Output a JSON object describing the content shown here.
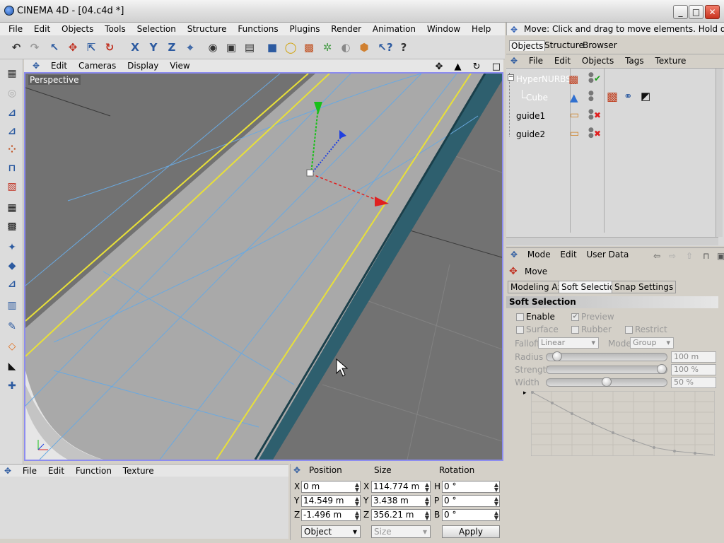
{
  "window": {
    "title": "CINEMA 4D - [04.c4d *]",
    "min": "_",
    "max": "□",
    "close": "✕"
  },
  "menu": [
    "File",
    "Edit",
    "Objects",
    "Tools",
    "Selection",
    "Structure",
    "Functions",
    "Plugins",
    "Render",
    "Animation",
    "Window",
    "Help"
  ],
  "status_hint": "Move: Click and drag to move elements. Hold down SHIFT",
  "viewport": {
    "menu": [
      "Edit",
      "Cameras",
      "Display",
      "View"
    ],
    "label": "Perspective"
  },
  "object_manager": {
    "tabs": [
      "Objects",
      "Structure",
      "Browser"
    ],
    "active_tab": "Objects",
    "menu": [
      "File",
      "Edit",
      "Objects",
      "Tags",
      "Texture"
    ],
    "objects": [
      {
        "name": "HyperNURBS",
        "status": "✔"
      },
      {
        "name": "Cube",
        "status": ""
      },
      {
        "name": "guide1",
        "status": "✖"
      },
      {
        "name": "guide2",
        "status": "✖"
      }
    ]
  },
  "attributes": {
    "menu": [
      "Mode",
      "Edit",
      "User Data"
    ],
    "tool": "Move",
    "tabs": [
      "Modeling Axis",
      "Soft Selection",
      "Snap Settings"
    ],
    "active_tab": "Soft Selection",
    "section": "Soft Selection",
    "enable": "Enable",
    "preview": "Preview",
    "surface": "Surface",
    "rubber": "Rubber",
    "restrict": "Restrict",
    "falloff_label": "Falloff",
    "falloff_value": "Linear",
    "mode_label": "Mode",
    "mode_value": "Group",
    "radius_label": "Radius",
    "radius_value": "100 m",
    "radius_level": 0.05,
    "strength_label": "Strength",
    "strength_value": "100 %",
    "strength_level": 1.0,
    "width_label": "Width",
    "width_value": "50 %",
    "width_level": 0.5
  },
  "material_manager": {
    "menu": [
      "File",
      "Edit",
      "Function",
      "Texture"
    ]
  },
  "coordinates": {
    "headers": [
      "Position",
      "Size",
      "Rotation"
    ],
    "rows": [
      {
        "pos_axis": "X",
        "pos": "0 m",
        "size_axis": "X",
        "size": "114.774 m",
        "rot_axis": "H",
        "rot": "0 °"
      },
      {
        "pos_axis": "Y",
        "pos": "14.549 m",
        "size_axis": "Y",
        "size": "3.438 m",
        "rot_axis": "P",
        "rot": "0 °"
      },
      {
        "pos_axis": "Z",
        "pos": "-1.496 m",
        "size_axis": "Z",
        "size": "356.21 m",
        "rot_axis": "B",
        "rot": "0 °"
      }
    ],
    "mode_select": "Object",
    "size_select": "Size",
    "apply": "Apply"
  },
  "colors": {
    "viewport_border": "#8c8cf0",
    "accent_blue": "#3060c0"
  }
}
